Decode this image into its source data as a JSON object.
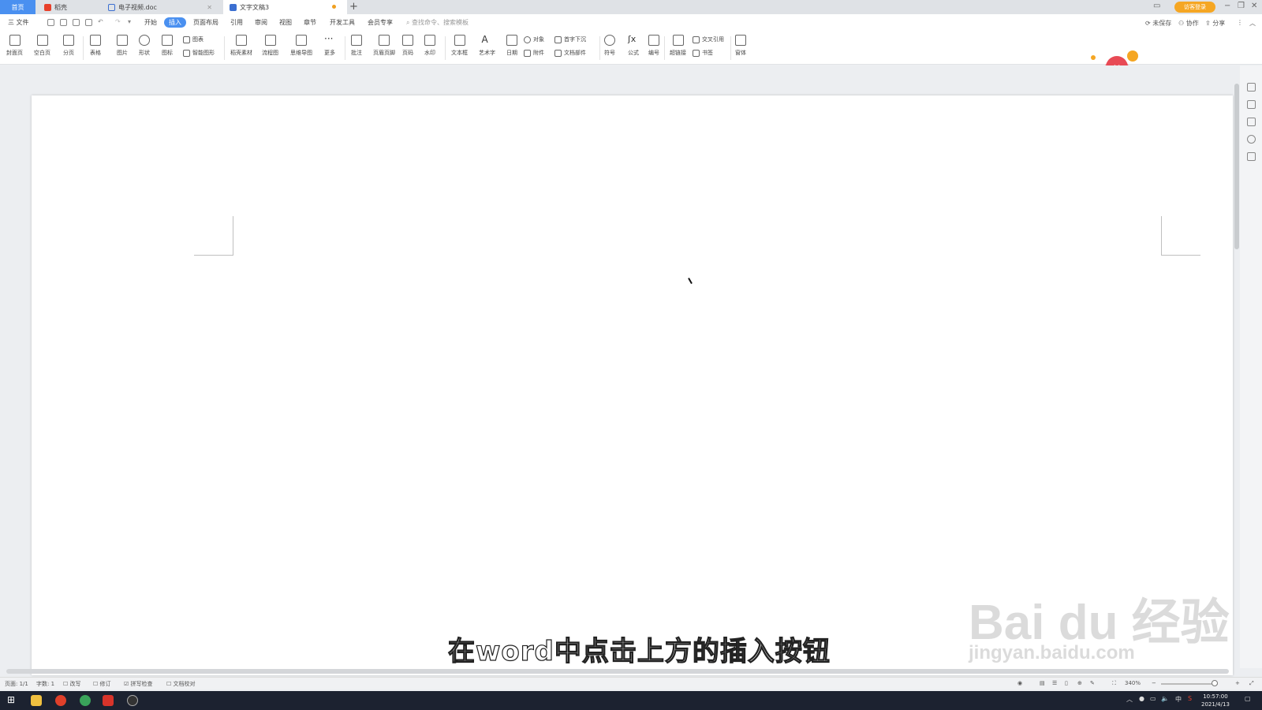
{
  "tabs": {
    "home": "首页",
    "daoke": "稻壳",
    "doc_file": "电子视频.doc",
    "active": "文字文稿3",
    "new_tab": "+",
    "login": "访客登录"
  },
  "menu": {
    "file": "三 文件",
    "items": [
      "开始",
      "插入",
      "页面布局",
      "引用",
      "审阅",
      "视图",
      "章节",
      "开发工具",
      "会员专享"
    ],
    "active_index": 1,
    "search_placeholder": "查找命令、搜索模板",
    "unsaved": "未保存",
    "collaborate": "协作",
    "share": "分享"
  },
  "ribbon": {
    "cover": "封面页",
    "blank": "空白页",
    "pagebreak": "分页",
    "table": "表格",
    "picture": "图片",
    "shape": "形状",
    "icon": "图标",
    "chart": "图表",
    "smart_shape": "智能图形",
    "daoke_material": "稻壳素材",
    "flowchart": "流程图",
    "mindmap": "思维导图",
    "more": "更多",
    "comment": "批注",
    "header_footer": "页眉页脚",
    "page_number": "页码",
    "watermark": "水印",
    "textbox": "文本框",
    "wordart": "艺术字",
    "date": "日期",
    "object": "对象",
    "attachment": "附件",
    "dropcap": "首字下沉",
    "doc_parts": "文档部件",
    "symbol": "符号",
    "formula": "公式",
    "numbering": "编号",
    "hyperlink": "超链接",
    "cross_ref": "交叉引用",
    "bookmark": "书签",
    "window": "窗体"
  },
  "subtitle": "在word中点击上方的插入按钮",
  "watermark": {
    "main": "Bai du 经验",
    "url": "jingyan.baidu.com"
  },
  "status": {
    "page": "页面: 1/1",
    "words": "字数: 1",
    "spellcheck_label": "改写",
    "revision": "修订",
    "spell": "拼写检查",
    "proof": "文档校对",
    "zoom": "340%",
    "minus": "−",
    "plus": "+"
  },
  "taskbar": {
    "ime": "中",
    "time": "10:57:00",
    "date": "2021/4/13"
  },
  "colors": {
    "accent": "#4a90f0",
    "login": "#f5a623",
    "taskbar": "#1c2230"
  }
}
